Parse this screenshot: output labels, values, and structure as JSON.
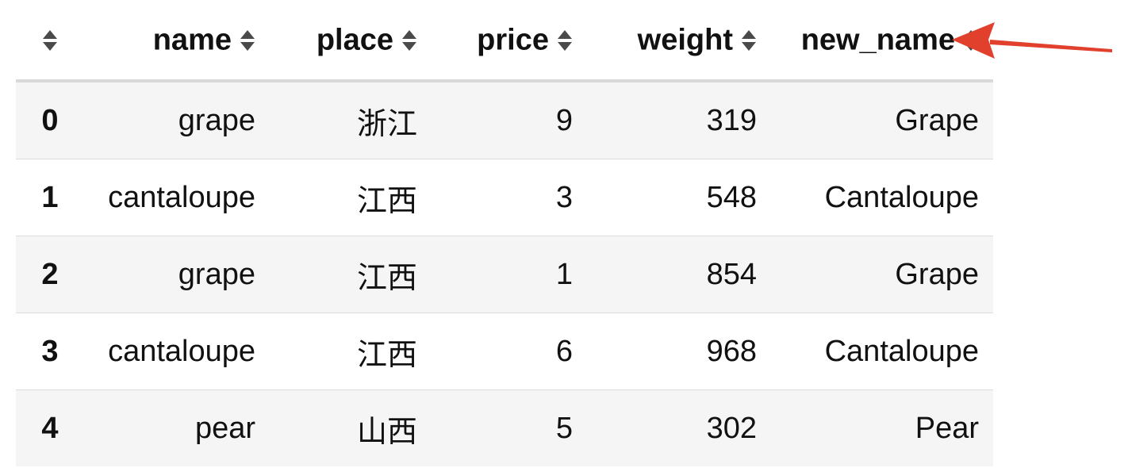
{
  "table": {
    "columns": [
      "name",
      "place",
      "price",
      "weight",
      "new_name"
    ],
    "rows": [
      {
        "index": "0",
        "name": "grape",
        "place": "浙江",
        "price": "9",
        "weight": "319",
        "new_name": "Grape"
      },
      {
        "index": "1",
        "name": "cantaloupe",
        "place": "江西",
        "price": "3",
        "weight": "548",
        "new_name": "Cantaloupe"
      },
      {
        "index": "2",
        "name": "grape",
        "place": "江西",
        "price": "1",
        "weight": "854",
        "new_name": "Grape"
      },
      {
        "index": "3",
        "name": "cantaloupe",
        "place": "江西",
        "price": "6",
        "weight": "968",
        "new_name": "Cantaloupe"
      },
      {
        "index": "4",
        "name": "pear",
        "place": "山西",
        "price": "5",
        "weight": "302",
        "new_name": "Pear"
      }
    ]
  },
  "icons": {
    "sort": "sort-icon",
    "annotation": "arrow-left-icon"
  },
  "colors": {
    "arrow": "#e0402c",
    "sort_icon": "#4a4a4a",
    "row_stripe": "#f5f5f5",
    "header_rule": "#d9d9d9"
  }
}
